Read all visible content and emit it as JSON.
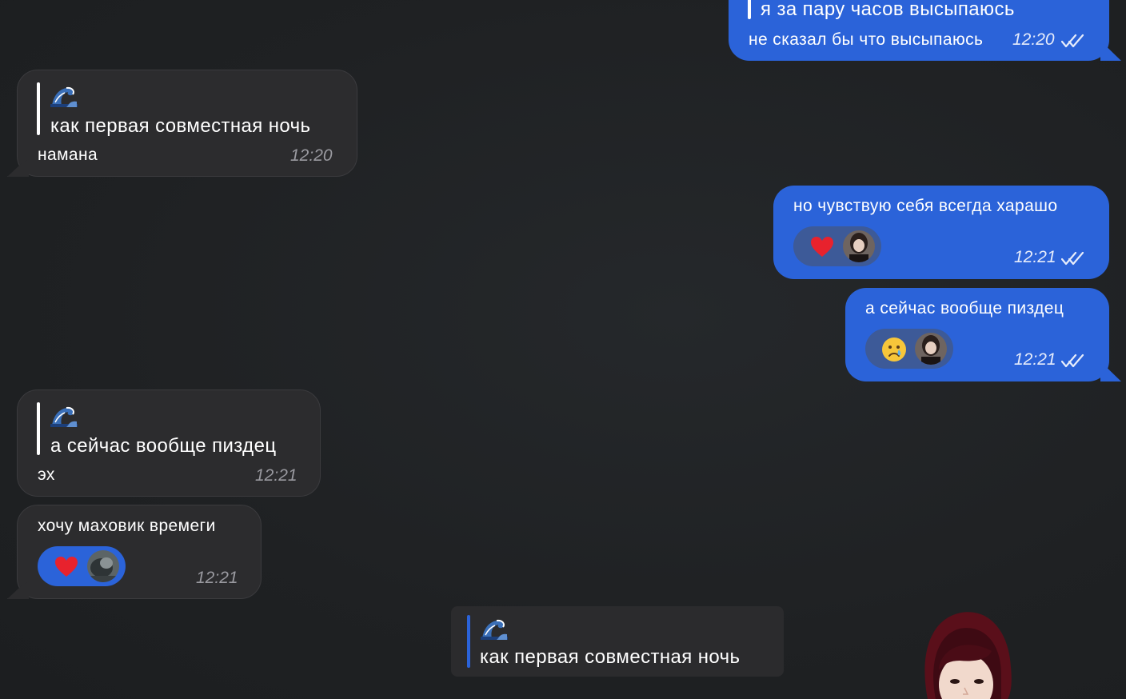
{
  "messages": [
    {
      "id": "m1",
      "direction": "outgoing",
      "reply_text": "я за пару часов высыпаюсь",
      "text": "не сказал бы что высыпаюсь",
      "time": "12:20",
      "read": true
    },
    {
      "id": "m2",
      "direction": "incoming",
      "reply_emoji": "wave-emoji",
      "reply_text": "как первая совместная ночь",
      "text": "намана",
      "time": "12:20"
    },
    {
      "id": "m3",
      "direction": "outgoing",
      "text": "но чувствую себя всегда харашо",
      "time": "12:21",
      "read": true,
      "reaction": "heart"
    },
    {
      "id": "m4",
      "direction": "outgoing",
      "text": "а сейчас вообще пиздец",
      "time": "12:21",
      "read": true,
      "reaction": "crying-face"
    },
    {
      "id": "m5",
      "direction": "incoming",
      "reply_emoji": "wave-emoji",
      "reply_text": "а сейчас вообще пиздец",
      "text": "эх",
      "time": "12:21"
    },
    {
      "id": "m6",
      "direction": "incoming",
      "text": "хочу маховик времеги",
      "time": "12:21",
      "reaction": "heart"
    }
  ],
  "pinned_reply": {
    "emoji": "wave-emoji",
    "text": "как первая совместная ночь"
  },
  "colors": {
    "background": "#1e2022",
    "incoming_bubble": "#2c2c2e",
    "outgoing_bubble": "#2b63d9",
    "heart": "#e8222d"
  }
}
